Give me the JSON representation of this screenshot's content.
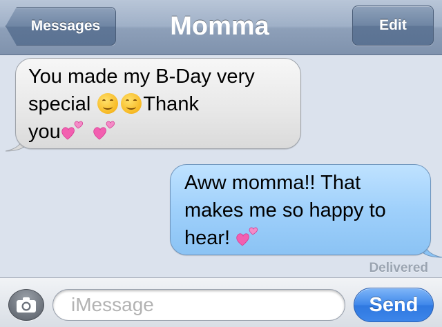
{
  "navbar": {
    "back_label": "Messages",
    "title": "Momma",
    "edit_label": "Edit"
  },
  "messages": [
    {
      "direction": "incoming",
      "line1": "You made my B-Day very",
      "line2_prefix": "special",
      "line2_suffix": "Thank",
      "line3": "you",
      "emojis": [
        "smiling-face",
        "smiling-face",
        "two-hearts",
        "two-hearts"
      ]
    },
    {
      "direction": "outgoing",
      "line1": "Aww momma!! That",
      "line2": "makes me so happy to",
      "line3": "hear!",
      "emojis": [
        "two-hearts"
      ],
      "status": "Delivered"
    }
  ],
  "composer": {
    "placeholder": "iMessage",
    "value": "",
    "send_label": "Send",
    "camera_icon": "camera-icon"
  },
  "colors": {
    "nav_bar": "#8ea0b9",
    "incoming_bubble": "#e7e7e7",
    "outgoing_bubble": "#9fd0fb",
    "send_button": "#3f87ea",
    "background": "#dbe2ed"
  }
}
